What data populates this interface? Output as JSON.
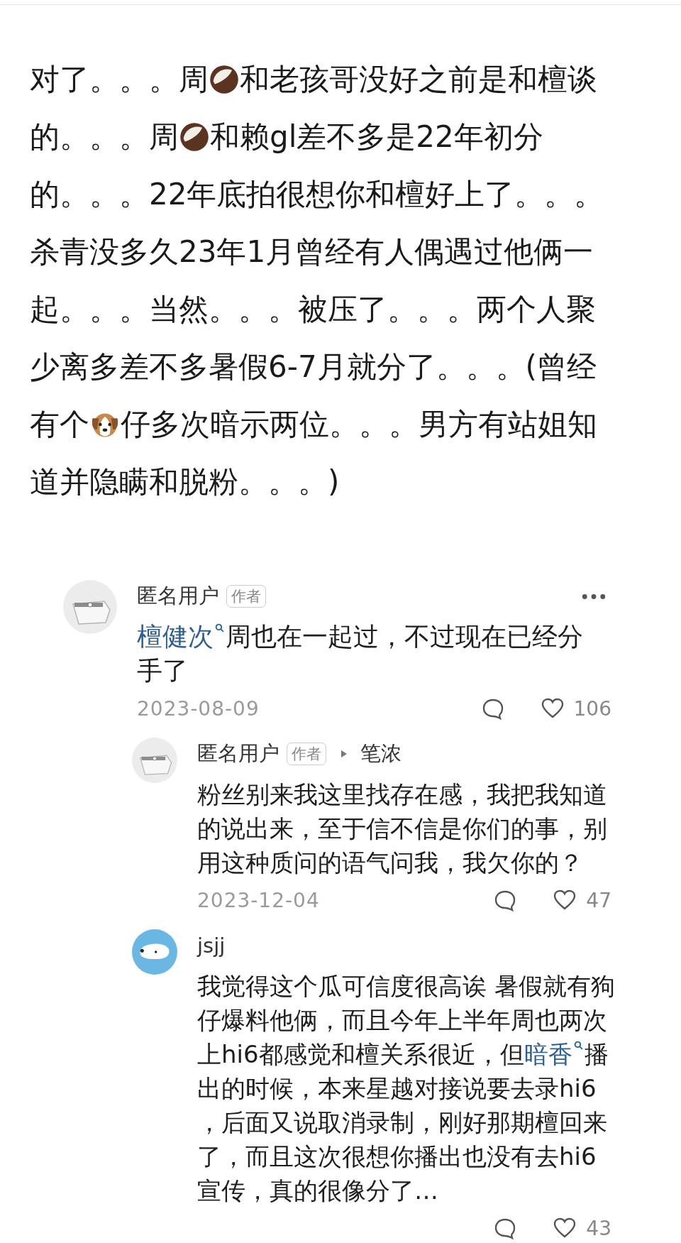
{
  "post": {
    "lines": [
      [
        {
          "kind": "text",
          "text": "对了。。。周"
        },
        {
          "kind": "coconut"
        },
        {
          "kind": "text",
          "text": "和老孩哥没好之前是和檀谈"
        }
      ],
      [
        {
          "kind": "text",
          "text": "的。。。周"
        },
        {
          "kind": "coconut"
        },
        {
          "kind": "text",
          "text": "和赖gl差不多是22年初分"
        }
      ],
      [
        {
          "kind": "text",
          "text": "的。。。22年底拍很想你和檀好上了。。。"
        }
      ],
      [
        {
          "kind": "text",
          "text": "杀青没多久23年1月曾经有人偶遇过他俩一"
        }
      ],
      [
        {
          "kind": "text",
          "text": "起。。。当然。。。被压了。。。两个人聚"
        }
      ],
      [
        {
          "kind": "text",
          "text": "少离多差不多暑假6-7月就分了。。。(曾经"
        }
      ],
      [
        {
          "kind": "text",
          "text": "有个"
        },
        {
          "kind": "puppy"
        },
        {
          "kind": "text",
          "text": "仔多次暗示两位。。。男方有站姐知"
        }
      ],
      [
        {
          "kind": "text",
          "text": "道并隐瞒和脱粉。。。)"
        }
      ]
    ]
  },
  "comment": {
    "author": "匿名用户",
    "badge": "作者",
    "kind": "masked",
    "segments": [
      {
        "kind": "link",
        "text": "檀健次"
      },
      {
        "kind": "plain",
        "text": "周也在一起过，不过现在已经分手了"
      }
    ],
    "date": "2023-08-09",
    "like_count": "106",
    "replies": [
      {
        "author": "匿名用户",
        "badge": "作者",
        "kind": "masked",
        "reply_to": "笔浓",
        "segments": [
          {
            "kind": "plain",
            "text": "粉丝别来我这里找存在感，我把我知道的说出来，至于信不信是你们的事，别用这种质问的语气问我，我欠你的？"
          }
        ],
        "date": "2023-12-04",
        "like_count": "47"
      },
      {
        "author": "jsjj",
        "kind": "bear",
        "segments": [
          {
            "kind": "plain",
            "text": "我觉得这个瓜可信度很高诶 暑假就有狗仔爆料他俩，而且今年上半年周也两次上hi6都感觉和檀关系很近，但"
          },
          {
            "kind": "link",
            "text": "暗香"
          },
          {
            "kind": "plain",
            "text": "播出的时候，本来星越对接说要去录hi6，后面又说取消录制，刚好那期檀回来了，而且这次很想你播出也没有去hi6宣传，真的很像分了…"
          }
        ],
        "like_count": "43"
      }
    ]
  }
}
